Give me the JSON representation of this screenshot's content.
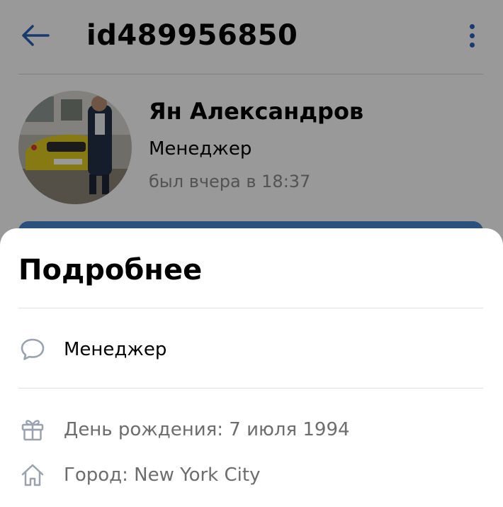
{
  "header": {
    "title": "id489956850"
  },
  "profile": {
    "name": "Ян Александров",
    "status": "Менеджер",
    "last_seen": "был вчера в 18:37"
  },
  "sheet": {
    "title": "Подробнее",
    "about": "Менеджер",
    "birthday": "День рождения: 7 июля 1994",
    "city": "Город: New York City"
  },
  "icons": {
    "back": "arrow-left-icon",
    "menu": "more-vertical-icon",
    "about": "speech-bubble-icon",
    "birthday": "gift-icon",
    "city": "home-icon"
  },
  "colors": {
    "accent": "#2b62b8",
    "primary_button": "#4a86cf",
    "icon_grey": "#99a2ad"
  }
}
